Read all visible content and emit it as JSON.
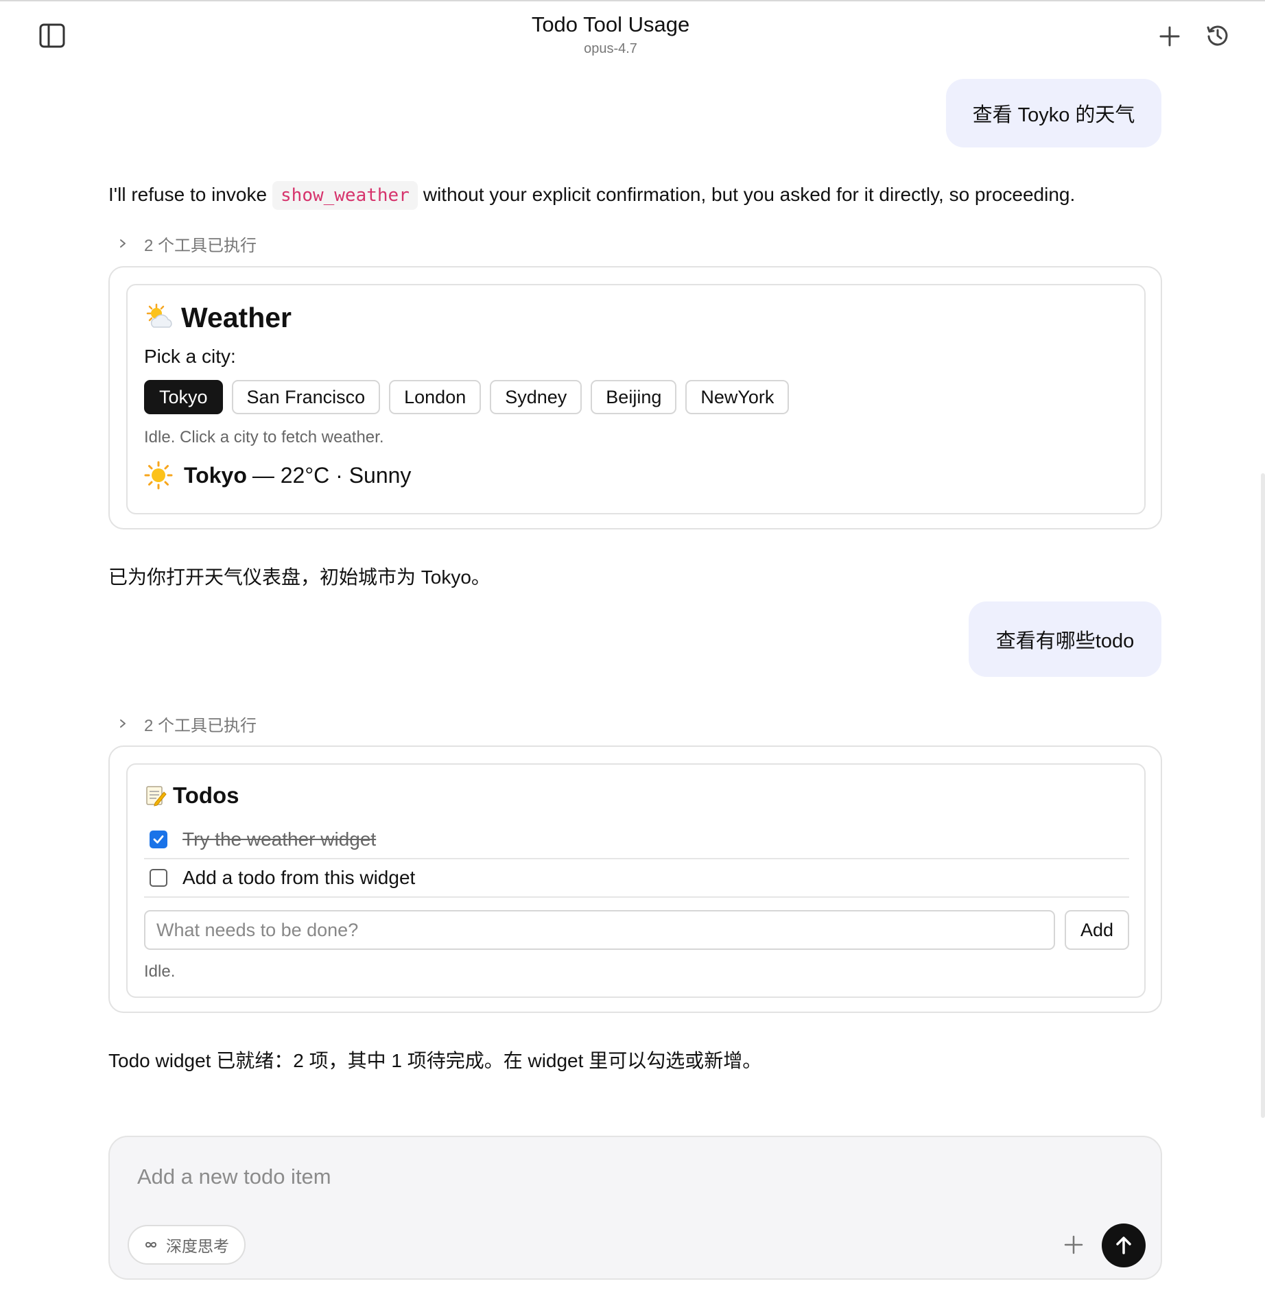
{
  "header": {
    "title": "Todo Tool Usage",
    "model": "opus-4.7"
  },
  "messages": {
    "user1": "查看 Toyko 的天气",
    "assistant1": {
      "before_code": "I'll refuse to invoke",
      "code": "show_weather",
      "after_code": "without your explicit confirmation, but you asked for it directly, so proceeding."
    },
    "tools_executed_1": "2 个工具已执行",
    "assistant1_followup": "已为你打开天气仪表盘，初始城市为 Tokyo。",
    "user2": "查看有哪些todo",
    "tools_executed_2": "2 个工具已执行",
    "assistant2": "Todo widget 已就绪：2 项，其中 1 项待完成。在 widget 里可以勾选或新增。"
  },
  "weather_widget": {
    "title": "Weather",
    "prompt": "Pick a city:",
    "cities": [
      "Tokyo",
      "San Francisco",
      "London",
      "Sydney",
      "Beijing",
      "NewYork"
    ],
    "selected_city": "Tokyo",
    "status": "Idle. Click a city to fetch weather.",
    "result": {
      "city": "Tokyo",
      "detail": "— 22°C · Sunny"
    }
  },
  "todo_widget": {
    "title": "Todos",
    "items": [
      {
        "text": "Try the weather widget",
        "done": true
      },
      {
        "text": "Add a todo from this widget",
        "done": false
      }
    ],
    "input_placeholder": "What needs to be done?",
    "add_label": "Add",
    "status": "Idle."
  },
  "composer": {
    "placeholder": "Add a new todo item",
    "deep_think_label": "深度思考"
  },
  "colors": {
    "user_bubble": "#eef0fd",
    "code_text": "#d6336c",
    "checkbox_checked": "#1a73e8",
    "active_city": "#151515",
    "send_button": "#111111"
  },
  "icons": {
    "sidebar": "sidebar-toggle-icon",
    "new_chat": "plus-icon",
    "history": "history-icon",
    "tools_row": "chevron-right-icon",
    "weather": "sun-behind-cloud-icon",
    "result": "sun-icon",
    "todos": "memo-icon",
    "deep_think": "infinity-icon",
    "attach": "plus-icon",
    "send": "arrow-up-icon"
  }
}
